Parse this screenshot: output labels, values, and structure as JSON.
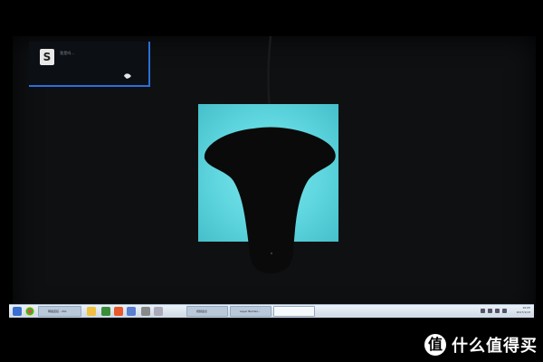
{
  "notification": {
    "app_letter": "S",
    "text": "我是吗..."
  },
  "taskbar": {
    "buttons": [
      {
        "label": "网络连接 - 20x"
      },
      {
        "label": "视频会议"
      },
      {
        "label": "Layer Builder..."
      },
      {
        "label": ""
      }
    ],
    "clock_time": "10:05",
    "clock_date": "2017/1/13"
  },
  "watermark": {
    "logo_letter": "值",
    "text": "什么值得买"
  },
  "colors": {
    "taskbar_bg": "#dde6ef",
    "window_fill": "#5fd6df",
    "notification_border": "#2c6fd9"
  }
}
